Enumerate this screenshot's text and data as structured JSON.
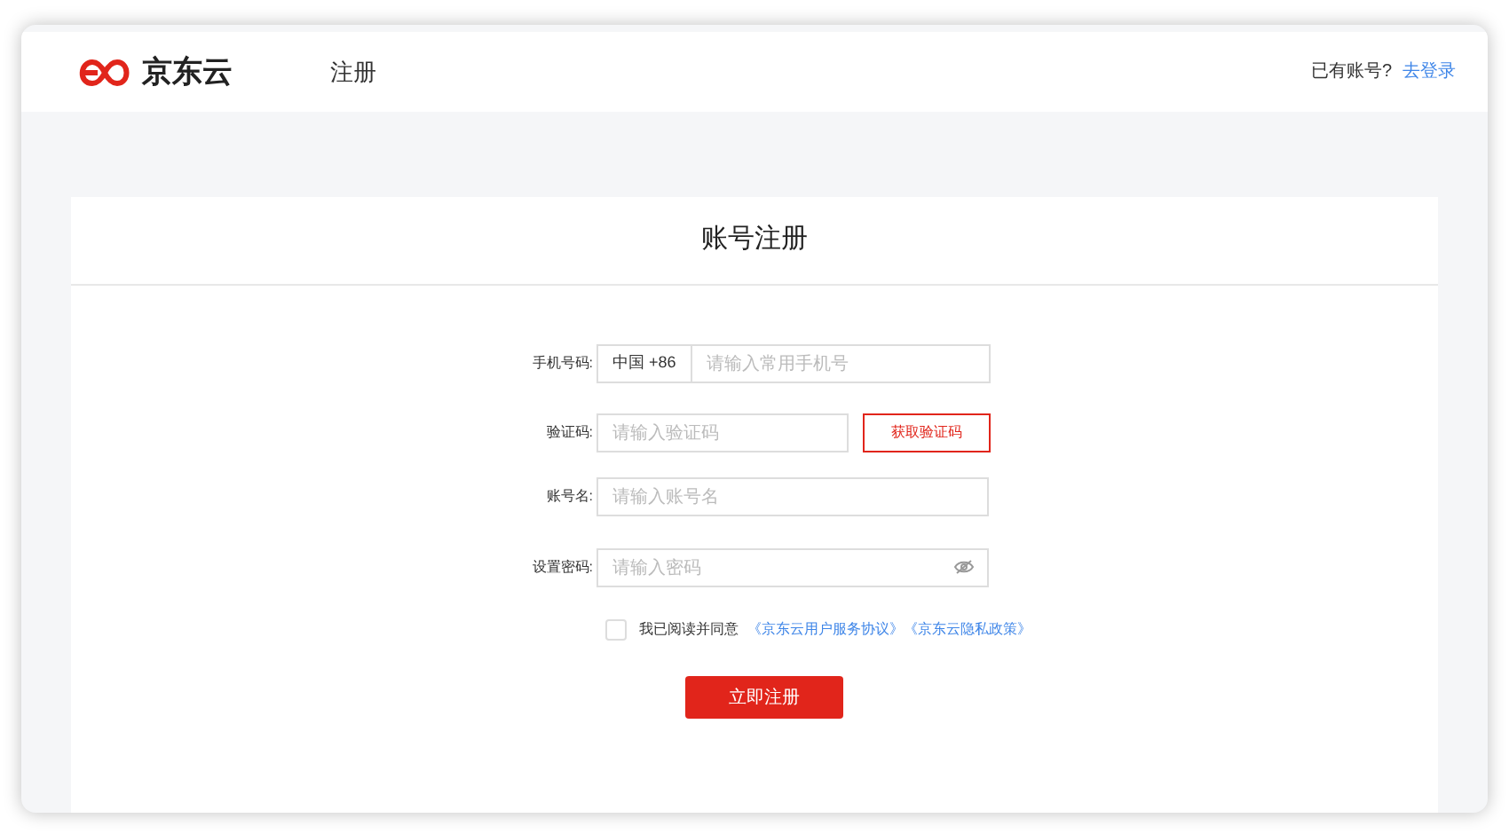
{
  "header": {
    "logo_text": "京东云",
    "nav_title": "注册",
    "login_prompt": "已有账号?",
    "login_link": "去登录"
  },
  "card": {
    "title": "账号注册"
  },
  "fields": [
    {
      "kind": "phone",
      "label": "手机号码:",
      "prefix": "中国 +86",
      "placeholder": "请输入常用手机号"
    },
    {
      "kind": "code",
      "label": "验证码:",
      "placeholder": "请输入验证码",
      "button": "获取验证码"
    },
    {
      "kind": "text",
      "label": "账号名:",
      "placeholder": "请输入账号名"
    },
    {
      "kind": "password",
      "label": "设置密码:",
      "placeholder": "请输入密码"
    }
  ],
  "agreement": {
    "checked": false,
    "text": "我已阅读并同意",
    "links": [
      "《京东云用户服务协议》",
      "《京东云隐私政策》"
    ]
  },
  "submit": "立即注册"
}
